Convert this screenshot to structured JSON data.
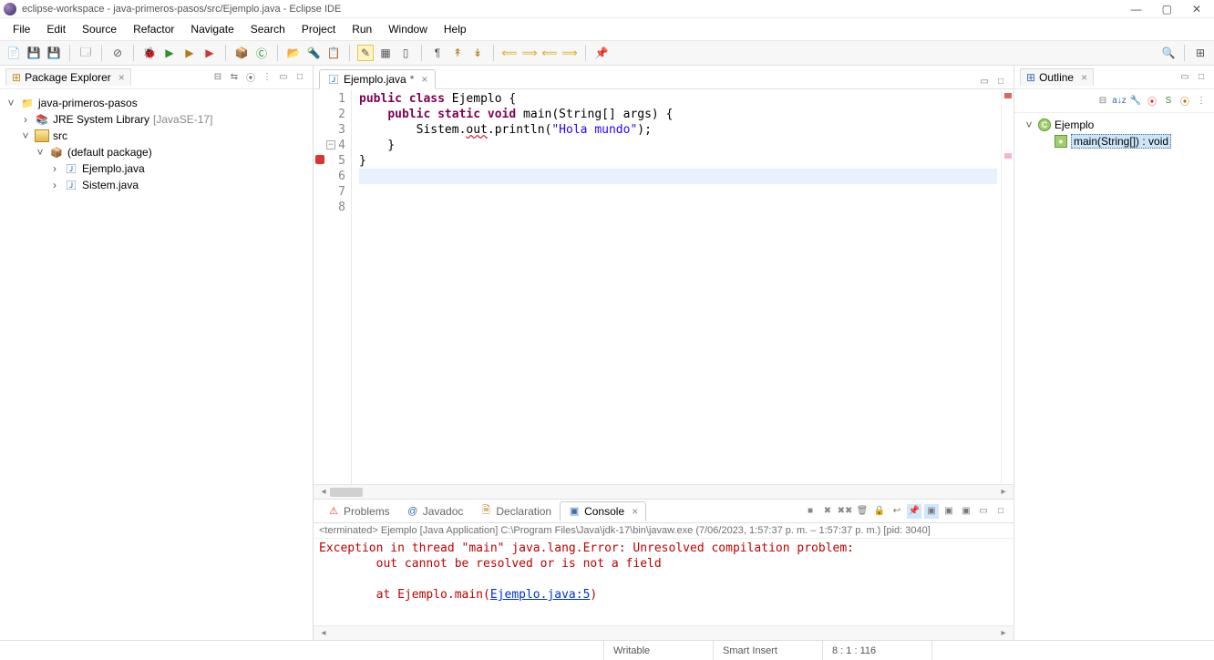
{
  "window": {
    "title": "eclipse-workspace - java-primeros-pasos/src/Ejemplo.java - Eclipse IDE"
  },
  "menus": [
    "File",
    "Edit",
    "Source",
    "Refactor",
    "Navigate",
    "Search",
    "Project",
    "Run",
    "Window",
    "Help"
  ],
  "packageExplorer": {
    "title": "Package Explorer",
    "project": "java-primeros-pasos",
    "jre": "JRE System Library",
    "jreVersion": "[JavaSE-17]",
    "src": "src",
    "defaultPkg": "(default package)",
    "file1": "Ejemplo.java",
    "file2": "Sistem.java"
  },
  "editor": {
    "tab": "Ejemplo.java",
    "lines": [
      {
        "n": "1",
        "raw": ""
      },
      {
        "n": "2",
        "raw": "public class Ejemplo {"
      },
      {
        "n": "3",
        "raw": ""
      },
      {
        "n": "4",
        "raw": "    public static void main(String[] args) {"
      },
      {
        "n": "5",
        "raw": "        Sistem.out.println(\"Hola mundo\");"
      },
      {
        "n": "6",
        "raw": "    }"
      },
      {
        "n": "7",
        "raw": "}"
      },
      {
        "n": "8",
        "raw": ""
      }
    ],
    "tokens": {
      "kw_public": "public",
      "kw_class": "class",
      "kw_static": "static",
      "kw_void": "void",
      "cls": "Ejemplo",
      "main": "main",
      "args": "(String[] args)",
      "sistem": "Sistem",
      "out": "out",
      "println": "println",
      "str": "\"Hola mundo\""
    }
  },
  "bottomTabs": {
    "problems": "Problems",
    "javadoc": "Javadoc",
    "declaration": "Declaration",
    "console": "Console"
  },
  "console": {
    "header": "<terminated> Ejemplo [Java Application] C:\\Program Files\\Java\\jdk-17\\bin\\javaw.exe  (7/06/2023, 1:57:37 p. m. – 1:57:37 p. m.) [pid: 3040]",
    "line1": "Exception in thread \"main\" java.lang.Error: Unresolved compilation problem: ",
    "line2": "        out cannot be resolved or is not a field",
    "line3": "",
    "line4a": "        at Ejemplo.main(",
    "line4link": "Ejemplo.java:5",
    "line4b": ")"
  },
  "outline": {
    "title": "Outline",
    "class": "Ejemplo",
    "method": "main(String[]) : void"
  },
  "status": {
    "writable": "Writable",
    "insert": "Smart Insert",
    "pos": "8 : 1 : 116"
  }
}
